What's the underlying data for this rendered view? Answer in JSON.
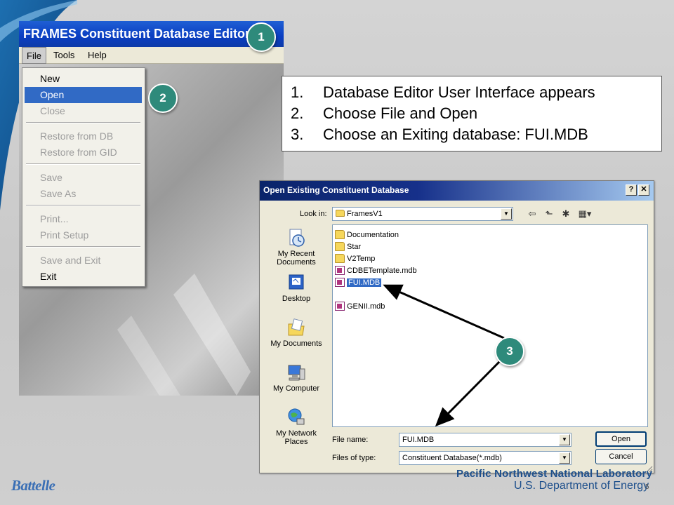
{
  "editor": {
    "title": "FRAMES Constituent Database Editor",
    "menubar": {
      "file": "File",
      "tools": "Tools",
      "help": "Help"
    },
    "file_menu": {
      "new": "New",
      "open": "Open",
      "close": "Close",
      "restore_db": "Restore from DB",
      "restore_gid": "Restore from GID",
      "save": "Save",
      "save_as": "Save As",
      "print": "Print...",
      "print_setup": "Print Setup",
      "save_exit": "Save and Exit",
      "exit": "Exit"
    }
  },
  "badges": {
    "one": "1",
    "two": "2",
    "three": "3"
  },
  "instructions": [
    {
      "num": "1.",
      "text": "Database Editor User Interface appears"
    },
    {
      "num": "2.",
      "text": "Choose File and Open"
    },
    {
      "num": "3.",
      "text": "Choose an Exiting database:  FUI.MDB"
    }
  ],
  "dialog": {
    "title": "Open Existing Constituent Database",
    "help_button": "?",
    "close_button": "✕",
    "look_in_label": "Look in:",
    "look_in_value": "FramesV1",
    "places": {
      "recent": "My Recent Documents",
      "desktop": "Desktop",
      "documents": "My Documents",
      "computer": "My Computer",
      "network": "My Network Places"
    },
    "files": [
      "Documentation",
      "Star",
      "V2Temp",
      "CDBETemplate.mdb",
      "FUI.MDB",
      "GENII.mdb"
    ],
    "file_name_label": "File name:",
    "file_name_value": "FUI.MDB",
    "file_type_label": "Files of type:",
    "file_type_value": "Constituent Database(*.mdb)",
    "open_button": "Open",
    "cancel_button": "Cancel"
  },
  "footer": {
    "logo": "Battelle",
    "org_line1": "Pacific Northwest National Laboratory",
    "org_line2": "U.S. Department of Energy",
    "slide_number": "5"
  },
  "colors": {
    "badge": "#2e8a7b",
    "selection": "#316ac5",
    "titlebar": "#0a3ec2",
    "org": "#1d4f8c"
  }
}
